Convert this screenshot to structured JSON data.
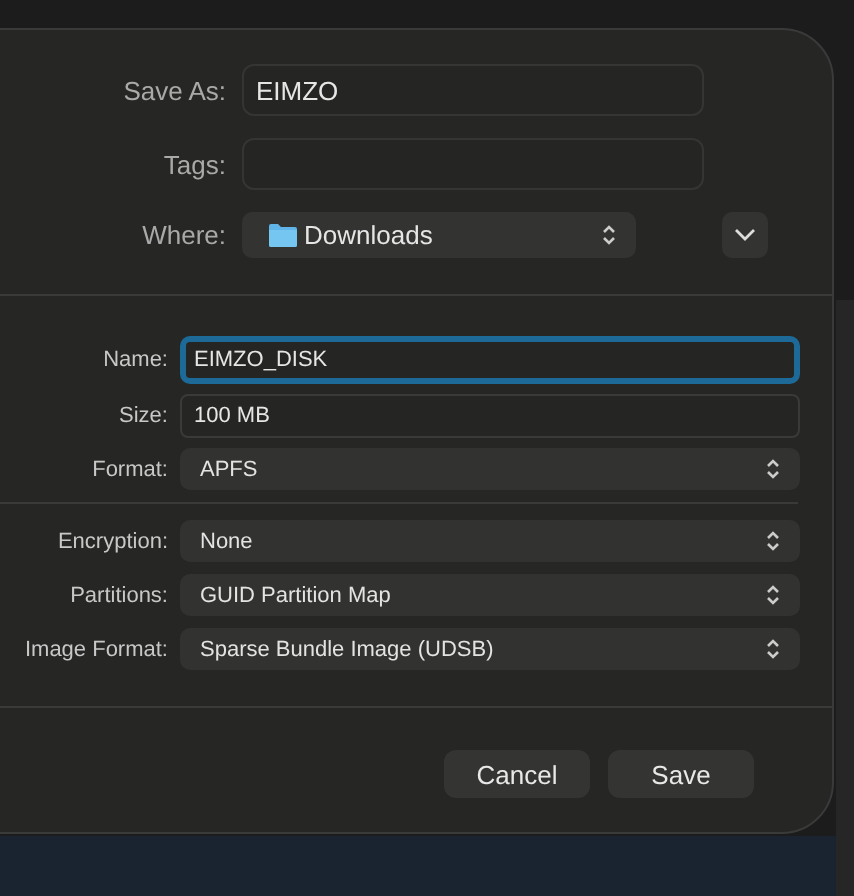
{
  "save_as": {
    "label": "Save As:",
    "value": "EIMZO"
  },
  "tags": {
    "label": "Tags:"
  },
  "where": {
    "label": "Where:",
    "value": "Downloads"
  },
  "image_fields": [
    {
      "kind": "text",
      "label": "Name:",
      "value": "EIMZO_DISK",
      "focused": true
    },
    {
      "kind": "text",
      "label": "Size:",
      "value": "100 MB",
      "focused": false
    },
    {
      "kind": "popup",
      "label": "Format:",
      "value": "APFS"
    }
  ],
  "options": [
    {
      "kind": "popup",
      "label": "Encryption:",
      "value": "None"
    },
    {
      "kind": "popup",
      "label": "Partitions:",
      "value": "GUID Partition Map"
    },
    {
      "kind": "popup",
      "label": "Image Format:",
      "value": "Sparse Bundle Image (UDSB)"
    }
  ],
  "buttons": [
    {
      "label": "Cancel"
    },
    {
      "label": "Save"
    }
  ]
}
